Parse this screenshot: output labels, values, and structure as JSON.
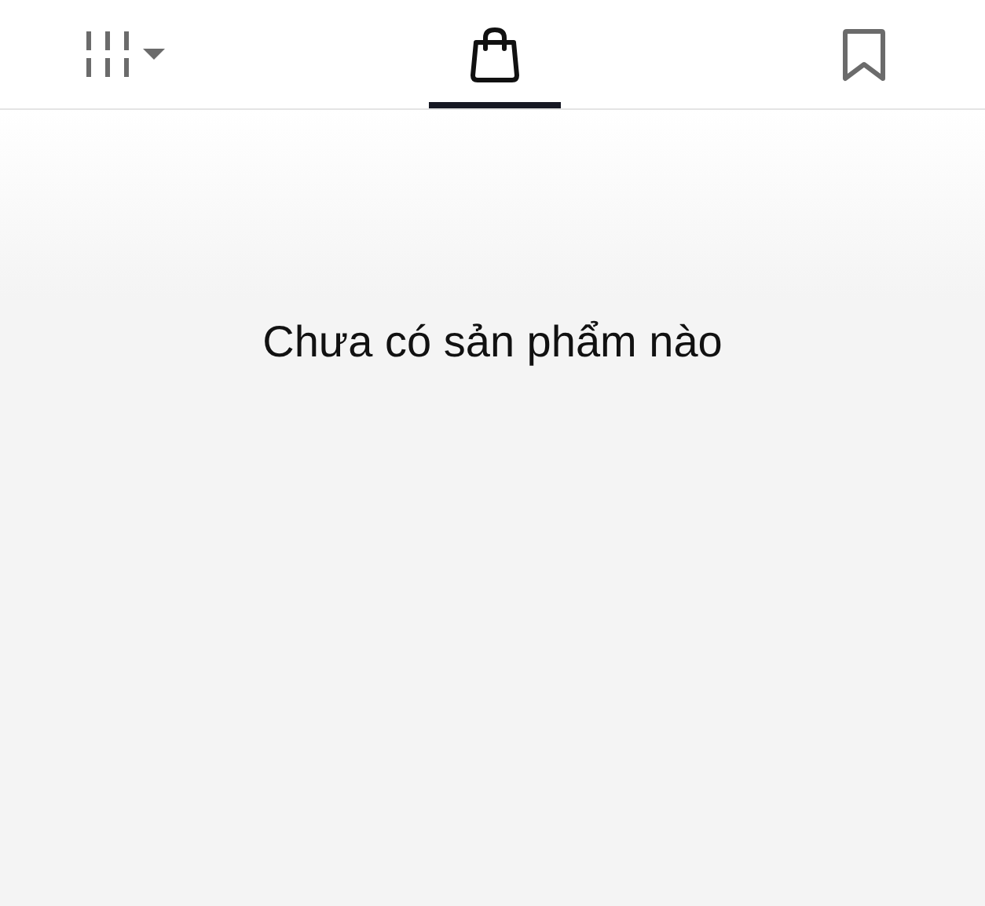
{
  "tabs": [
    {
      "kind": "grid",
      "selected": false
    },
    {
      "kind": "bag",
      "selected": true
    },
    {
      "kind": "bookmark",
      "selected": false
    }
  ],
  "empty_message": "Chưa có sản phẩm nào"
}
